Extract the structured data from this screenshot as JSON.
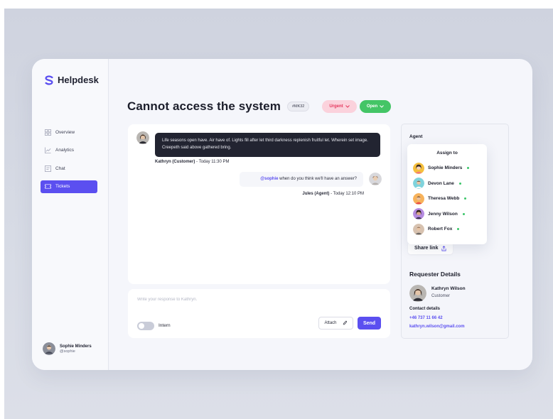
{
  "app": {
    "name": "Helpdesk",
    "brand_color": "#5b4ff0"
  },
  "sidebar": {
    "items": [
      {
        "label": "Overview",
        "icon": "grid-icon",
        "active": false
      },
      {
        "label": "Analytics",
        "icon": "chart-icon",
        "active": false
      },
      {
        "label": "Chat",
        "icon": "chat-icon",
        "active": false
      },
      {
        "label": "Tickets",
        "icon": "ticket-icon",
        "active": true
      }
    ],
    "profile": {
      "name": "Sophie Minders",
      "handle": "@sophie"
    }
  },
  "ticket": {
    "title": "Cannot access the system",
    "id": "#MK32",
    "priority": {
      "label": "Urgent",
      "color": "#e5385e"
    },
    "status": {
      "label": "Open",
      "color": "#44c566"
    }
  },
  "messages": [
    {
      "text": "Life seasons open have. Air have of. Lights fill after let third darkness replenish fruitful let. Wherein set image. Creepeth said above gathered bring.",
      "author": "Kathryn (Customer)",
      "time": "Today 11:30 PM",
      "separator": " - "
    },
    {
      "mention": "@sophie",
      "text": " when do you think we'll have an answer?",
      "author": "Jules (Agent)",
      "time": "Today 12:10 PM",
      "separator": " - "
    }
  ],
  "reply": {
    "placeholder": "Write your response to Kathryn.",
    "intern_label": "Intern",
    "attach_label": "Attach",
    "send_label": "Send"
  },
  "agent_panel": {
    "label": "Agent",
    "assign_title": "Assign to",
    "agents": [
      {
        "name": "Sophie Minders",
        "online": true
      },
      {
        "name": "Devon Lane",
        "online": true
      },
      {
        "name": "Theresa Webb",
        "online": true
      },
      {
        "name": "Jenny Wilson",
        "online": true
      },
      {
        "name": "Robert Fox",
        "online": true
      }
    ],
    "share_link_label": "Share link"
  },
  "requester": {
    "section_title": "Requester Details",
    "name": "Kathryn Wilson",
    "role": "Customer",
    "contact_label": "Contact details",
    "phone": "+46 737 11 66 42",
    "email": "kathryn.wilson@gmail.com"
  }
}
